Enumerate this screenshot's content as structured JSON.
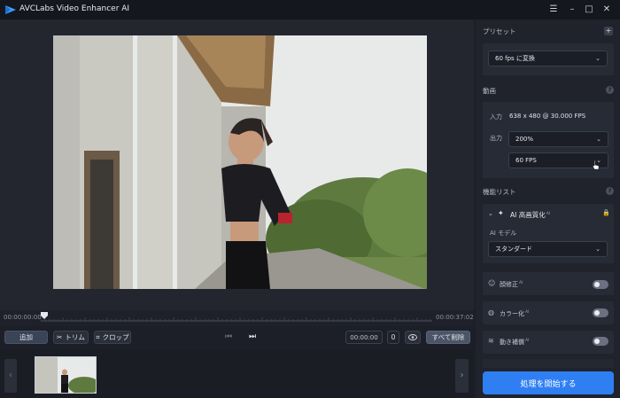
{
  "titlebar": {
    "title": "AVCLabs Video Enhancer AI",
    "icons": [
      "menu-icon",
      "minimize-icon",
      "maximize-icon",
      "close-icon"
    ]
  },
  "timeline": {
    "start_time": "00:00:00:00",
    "end_time": "00:00:37:02"
  },
  "toolbar": {
    "add_label": "追加",
    "trim_label": "トリム",
    "crop_label": "クロップ",
    "time_value": "00:00:00",
    "frame_value": "0",
    "clear_label": "すべて削除"
  },
  "panel": {
    "preset_title": "プリセット",
    "preset_value": "60 fps に変換",
    "video_title": "動画",
    "input_label": "入力",
    "input_value": "638 x 480 @ 30.000 FPS",
    "output_label": "出力",
    "output_scale": "200%",
    "output_fps": "60 FPS",
    "feature_list_title": "機能リスト",
    "ai_upscale": {
      "label": "AI 高画質化",
      "model_label": "AI モデル",
      "model_value": "スタンダード"
    },
    "features": [
      {
        "label": "顔修正",
        "on": false
      },
      {
        "label": "カラー化",
        "on": false
      },
      {
        "label": "動き補償",
        "on": false
      }
    ],
    "start_label": "処理を開始する"
  },
  "colors": {
    "accent": "#2f7ff3",
    "background": "#1c1f28",
    "panel": "#20232b"
  }
}
